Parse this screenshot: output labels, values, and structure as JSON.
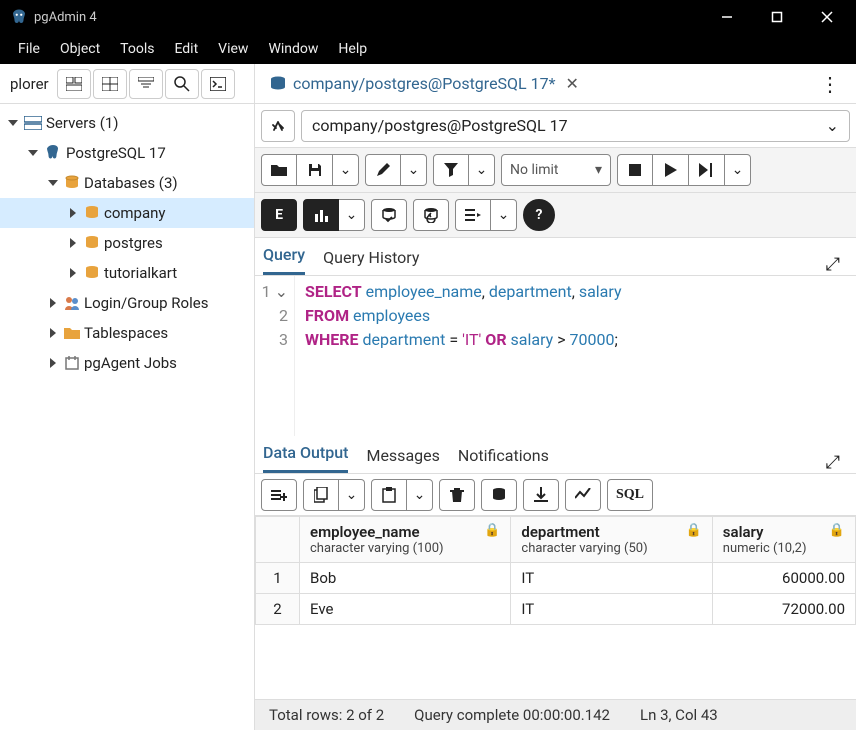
{
  "window": {
    "title": "pgAdmin 4"
  },
  "menu": [
    "File",
    "Object",
    "Tools",
    "Edit",
    "View",
    "Window",
    "Help"
  ],
  "sidebar": {
    "label": "plorer",
    "servers": "Servers (1)",
    "pg": "PostgreSQL 17",
    "dbs": "Databases (3)",
    "db1": "company",
    "db2": "postgres",
    "db3": "tutorialkart",
    "roles": "Login/Group Roles",
    "tbs": "Tablespaces",
    "agent": "pgAgent Jobs"
  },
  "tab": {
    "label": "company/postgres@PostgreSQL 17*"
  },
  "conn": {
    "label": "company/postgres@PostgreSQL 17"
  },
  "limit": "No limit",
  "qtabs": {
    "q": "Query",
    "h": "Query History"
  },
  "sql": {
    "line": [
      "1",
      "2",
      "3"
    ],
    "l1_kw": "SELECT",
    "l1_c1": "employee_name",
    "l1_c2": "department",
    "l1_c3": "salary",
    "l2_kw": "FROM",
    "l2_tbl": "employees",
    "l3_kw1": "WHERE",
    "l3_col1": "department",
    "l3_str": "'IT'",
    "l3_kw2": "OR",
    "l3_col2": "salary",
    "l3_num": "70000"
  },
  "otabs": {
    "d": "Data Output",
    "m": "Messages",
    "n": "Notifications"
  },
  "sqlbtn": "SQL",
  "cols": [
    {
      "name": "employee_name",
      "type": "character varying (100)"
    },
    {
      "name": "department",
      "type": "character varying (50)"
    },
    {
      "name": "salary",
      "type": "numeric (10,2)"
    }
  ],
  "rows": [
    {
      "n": "1",
      "c0": "Bob",
      "c1": "IT",
      "c2": "60000.00"
    },
    {
      "n": "2",
      "c0": "Eve",
      "c1": "IT",
      "c2": "72000.00"
    }
  ],
  "status": {
    "rows": "Total rows: 2 of 2",
    "time": "Query complete 00:00:00.142",
    "pos": "Ln 3, Col 43"
  }
}
